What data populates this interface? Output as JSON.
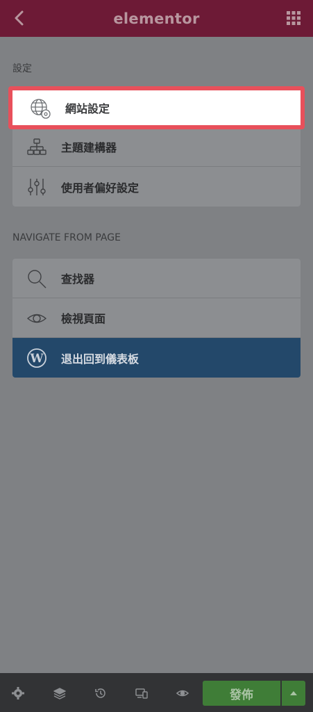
{
  "header": {
    "logo_text": "elementor"
  },
  "settings_section": {
    "title": "設定",
    "items": [
      {
        "label": "網站設定",
        "icon": "globe-gear-icon"
      },
      {
        "label": "主題建構器",
        "icon": "sitemap-icon"
      },
      {
        "label": "使用者偏好設定",
        "icon": "sliders-icon"
      }
    ]
  },
  "navigate_section": {
    "title": "NAVIGATE FROM PAGE",
    "items": [
      {
        "label": "查找器",
        "icon": "search-icon"
      },
      {
        "label": "檢視頁面",
        "icon": "eye-icon"
      },
      {
        "label": "退出回到儀表板",
        "icon": "wordpress-icon"
      }
    ]
  },
  "footer": {
    "publish_label": "發佈"
  },
  "colors": {
    "header_bg": "#6d1a36",
    "highlight_border": "#e8505b",
    "wordpress_row_bg": "#23486a",
    "publish_bg": "#3f7d37"
  }
}
